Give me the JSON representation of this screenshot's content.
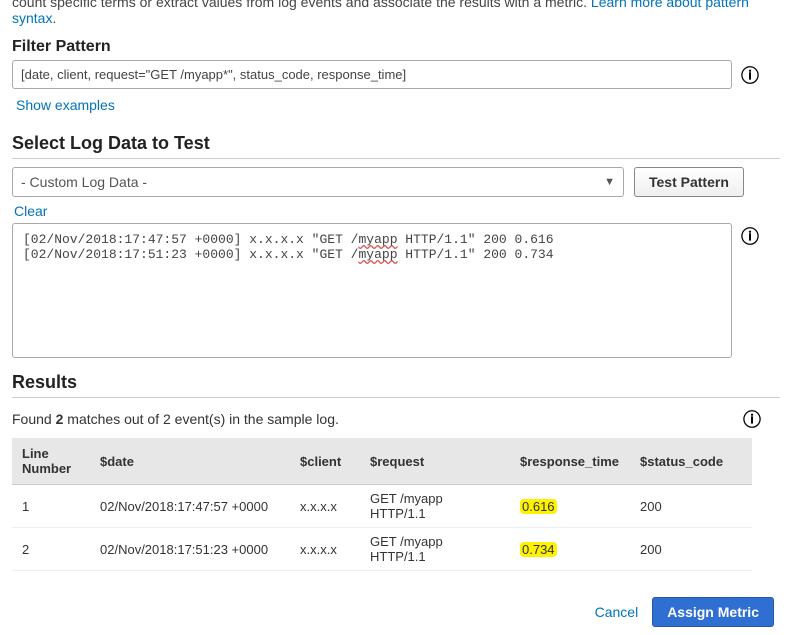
{
  "intro": {
    "fragment": "count specific terms or extract values from log events and associate the results with a metric. ",
    "link_text": "Learn more about pattern syntax",
    "tail": "."
  },
  "filter": {
    "label": "Filter Pattern",
    "value": "[date, client, request=\"GET /myapp*\", status_code, response_time]",
    "show_examples": "Show examples"
  },
  "select": {
    "header": "Select Log Data to Test",
    "dropdown_value": "- Custom Log Data -",
    "test_button": "Test Pattern",
    "clear": "Clear"
  },
  "log": {
    "lines": [
      {
        "ts": "[02/Nov/2018:17:47:57 +0000]",
        "ip": "x.x.x.x",
        "q": "\"GET /",
        "app": "myapp",
        "rest": " HTTP/1.1\" 200 0.616"
      },
      {
        "ts": "[02/Nov/2018:17:51:23 +0000]",
        "ip": "x.x.x.x",
        "q": "\"GET /",
        "app": "myapp",
        "rest": " HTTP/1.1\" 200 0.734"
      }
    ]
  },
  "results": {
    "header": "Results",
    "summary_pre": "Found ",
    "summary_bold": "2",
    "summary_post": " matches out of 2 event(s) in the sample log.",
    "columns": [
      "Line Number",
      "$date",
      "$client",
      "$request",
      "$response_time",
      "$status_code"
    ],
    "rows": [
      {
        "line": "1",
        "date": "02/Nov/2018:17:47:57 +0000",
        "client": "x.x.x.x",
        "request": "GET /myapp HTTP/1.1",
        "response_time": "0.616",
        "status_code": "200"
      },
      {
        "line": "2",
        "date": "02/Nov/2018:17:51:23 +0000",
        "client": "x.x.x.x",
        "request": "GET /myapp HTTP/1.1",
        "response_time": "0.734",
        "status_code": "200"
      }
    ]
  },
  "footer": {
    "cancel": "Cancel",
    "assign": "Assign Metric"
  },
  "icons": {
    "info": "ℹ",
    "caret": "▼"
  },
  "chart_data": {
    "type": "table",
    "title": "Results",
    "columns": [
      "Line Number",
      "$date",
      "$client",
      "$request",
      "$response_time",
      "$status_code"
    ],
    "rows": [
      [
        1,
        "02/Nov/2018:17:47:57 +0000",
        "x.x.x.x",
        "GET /myapp HTTP/1.1",
        0.616,
        200
      ],
      [
        2,
        "02/Nov/2018:17:51:23 +0000",
        "x.x.x.x",
        "GET /myapp HTTP/1.1",
        0.734,
        200
      ]
    ]
  }
}
